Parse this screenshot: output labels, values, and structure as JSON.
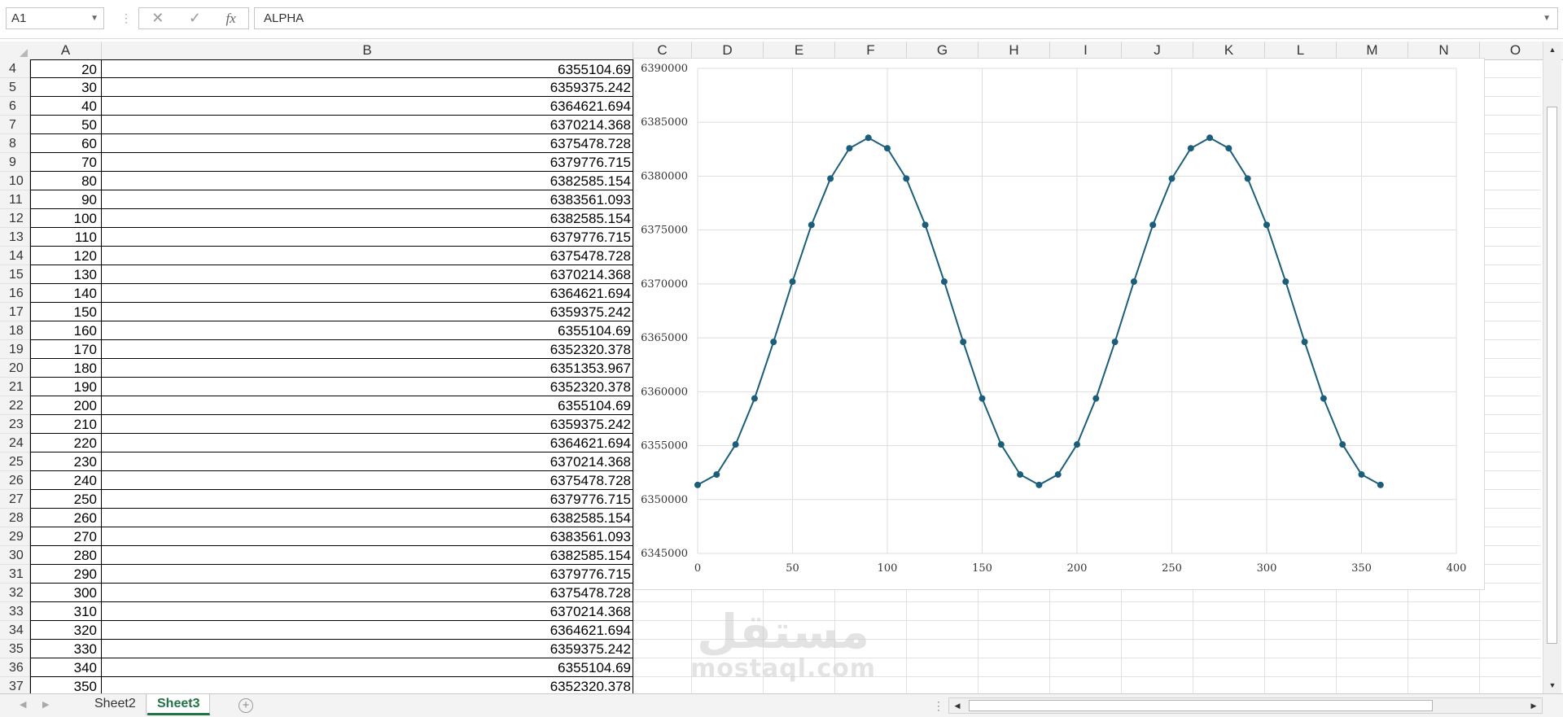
{
  "formula_bar": {
    "name_box": "A1",
    "fx_label": "fx",
    "formula": "ALPHA"
  },
  "columns": [
    "A",
    "B",
    "C",
    "D",
    "E",
    "F",
    "G",
    "H",
    "I",
    "J",
    "K",
    "L",
    "M",
    "N",
    "O"
  ],
  "rows": [
    {
      "num": "4",
      "a": "20",
      "b": "6355104.69"
    },
    {
      "num": "5",
      "a": "30",
      "b": "6359375.242"
    },
    {
      "num": "6",
      "a": "40",
      "b": "6364621.694"
    },
    {
      "num": "7",
      "a": "50",
      "b": "6370214.368"
    },
    {
      "num": "8",
      "a": "60",
      "b": "6375478.728"
    },
    {
      "num": "9",
      "a": "70",
      "b": "6379776.715"
    },
    {
      "num": "10",
      "a": "80",
      "b": "6382585.154"
    },
    {
      "num": "11",
      "a": "90",
      "b": "6383561.093"
    },
    {
      "num": "12",
      "a": "100",
      "b": "6382585.154"
    },
    {
      "num": "13",
      "a": "110",
      "b": "6379776.715"
    },
    {
      "num": "14",
      "a": "120",
      "b": "6375478.728"
    },
    {
      "num": "15",
      "a": "130",
      "b": "6370214.368"
    },
    {
      "num": "16",
      "a": "140",
      "b": "6364621.694"
    },
    {
      "num": "17",
      "a": "150",
      "b": "6359375.242"
    },
    {
      "num": "18",
      "a": "160",
      "b": "6355104.69"
    },
    {
      "num": "19",
      "a": "170",
      "b": "6352320.378"
    },
    {
      "num": "20",
      "a": "180",
      "b": "6351353.967"
    },
    {
      "num": "21",
      "a": "190",
      "b": "6352320.378"
    },
    {
      "num": "22",
      "a": "200",
      "b": "6355104.69"
    },
    {
      "num": "23",
      "a": "210",
      "b": "6359375.242"
    },
    {
      "num": "24",
      "a": "220",
      "b": "6364621.694"
    },
    {
      "num": "25",
      "a": "230",
      "b": "6370214.368"
    },
    {
      "num": "26",
      "a": "240",
      "b": "6375478.728"
    },
    {
      "num": "27",
      "a": "250",
      "b": "6379776.715"
    },
    {
      "num": "28",
      "a": "260",
      "b": "6382585.154"
    },
    {
      "num": "29",
      "a": "270",
      "b": "6383561.093"
    },
    {
      "num": "30",
      "a": "280",
      "b": "6382585.154"
    },
    {
      "num": "31",
      "a": "290",
      "b": "6379776.715"
    },
    {
      "num": "32",
      "a": "300",
      "b": "6375478.728"
    },
    {
      "num": "33",
      "a": "310",
      "b": "6370214.368"
    },
    {
      "num": "34",
      "a": "320",
      "b": "6364621.694"
    },
    {
      "num": "35",
      "a": "330",
      "b": "6359375.242"
    },
    {
      "num": "36",
      "a": "340",
      "b": "6355104.69"
    },
    {
      "num": "37",
      "a": "350",
      "b": "6352320.378"
    }
  ],
  "chart_data": {
    "type": "scatter",
    "xlim": [
      0,
      400
    ],
    "ylim": [
      6345000,
      6390000
    ],
    "x_ticks": [
      "0",
      "50",
      "100",
      "150",
      "200",
      "250",
      "300",
      "350",
      "400"
    ],
    "y_ticks": [
      "6345000",
      "6350000",
      "6355000",
      "6360000",
      "6365000",
      "6370000",
      "6375000",
      "6380000",
      "6385000",
      "6390000"
    ],
    "grid": true,
    "series": [
      {
        "color": "#1b5e7a",
        "x": [
          0,
          10,
          20,
          30,
          40,
          50,
          60,
          70,
          80,
          90,
          100,
          110,
          120,
          130,
          140,
          150,
          160,
          170,
          180,
          190,
          200,
          210,
          220,
          230,
          240,
          250,
          260,
          270,
          280,
          290,
          300,
          310,
          320,
          330,
          340,
          350,
          360
        ],
        "y": [
          6351353.967,
          6352320.378,
          6355104.69,
          6359375.242,
          6364621.694,
          6370214.368,
          6375478.728,
          6379776.715,
          6382585.154,
          6383561.093,
          6382585.154,
          6379776.715,
          6375478.728,
          6370214.368,
          6364621.694,
          6359375.242,
          6355104.69,
          6352320.378,
          6351353.967,
          6352320.378,
          6355104.69,
          6359375.242,
          6364621.694,
          6370214.368,
          6375478.728,
          6379776.715,
          6382585.154,
          6383561.093,
          6382585.154,
          6379776.715,
          6375478.728,
          6370214.368,
          6364621.694,
          6359375.242,
          6355104.69,
          6352320.378,
          6351353.967
        ]
      }
    ]
  },
  "watermark": {
    "arabic": "مستقل",
    "latin": "mostaql.com"
  },
  "sheets": [
    {
      "label": "Sheet2",
      "active": false
    },
    {
      "label": "Sheet3",
      "active": true
    }
  ],
  "icons": {
    "cancel": "✕",
    "enter": "✓",
    "add": "+",
    "dots": "⋮",
    "nav_prev": "◀",
    "nav_next": "▶"
  }
}
